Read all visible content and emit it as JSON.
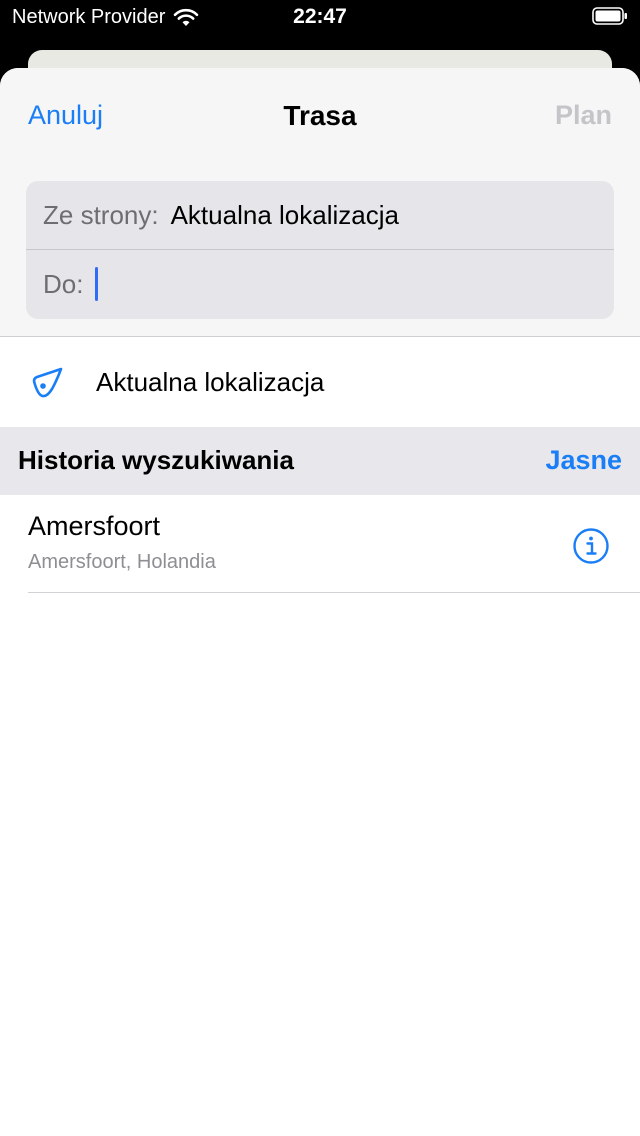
{
  "status_bar": {
    "carrier": "Network Provider",
    "time": "22:47"
  },
  "nav": {
    "cancel": "Anuluj",
    "title": "Trasa",
    "plan": "Plan"
  },
  "route": {
    "from_label": "Ze strony:",
    "from_value": "Aktualna lokalizacja",
    "to_label": "Do:",
    "to_value": ""
  },
  "current_location": {
    "label": "Aktualna lokalizacja",
    "icon": "location-arrow-icon"
  },
  "history": {
    "title": "Historia wyszukiwania",
    "clear": "Jasne",
    "items": [
      {
        "title": "Amersfoort",
        "subtitle": "Amersfoort, Holandia",
        "icon": "info-icon"
      }
    ]
  },
  "colors": {
    "accent": "#1a7ef6",
    "disabled": "#c5c5c9",
    "caret": "#2f6df6"
  }
}
